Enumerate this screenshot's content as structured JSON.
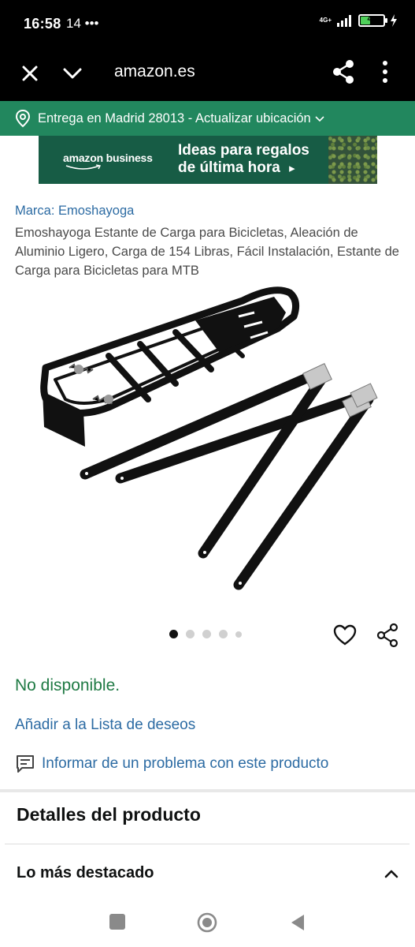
{
  "status_bar": {
    "time": "16:58",
    "extra": "14 •••",
    "network": "4G+",
    "battery_level": "41",
    "battery_fill_fraction": 0.41,
    "battery_color": "#4fd05a"
  },
  "browser": {
    "url": "amazon.es",
    "icons": [
      "close-icon",
      "chevron-down-icon",
      "share-icon",
      "more-vertical-icon"
    ]
  },
  "delivery": {
    "text": "Entrega en Madrid 28013 - Actualizar ubicación",
    "background_color": "#22875e"
  },
  "banner": {
    "brand": "amazon business",
    "promo_line1": "Ideas para regalos",
    "promo_line2": "de última hora",
    "arrow": "▸",
    "background_color": "#175c45"
  },
  "product": {
    "brand_link": "Marca: Emoshayoga",
    "title": "Emoshayoga Estante de Carga para Bicicletas, Aleación de Aluminio Ligero, Carga de 154 Libras, Fácil Instalación, Estante de Carga para Bicicletas para MTB",
    "image_count": 5,
    "active_image_index": 0,
    "availability": "No disponible.",
    "wishlist_link": "Añadir a la Lista de deseos",
    "report_link": "Informar de un problema con este producto"
  },
  "details": {
    "title": "Detalles del producto",
    "highlights_label": "Lo más destacado"
  },
  "colors": {
    "link": "#2c6ba3",
    "availability": "#1f7a44"
  }
}
